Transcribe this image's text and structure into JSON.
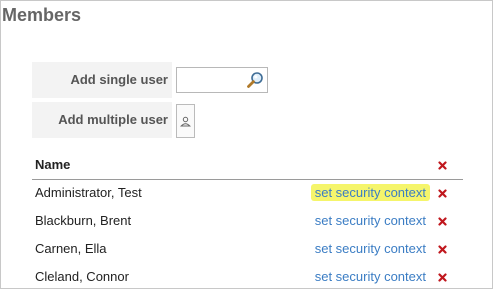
{
  "panel": {
    "title": "Members"
  },
  "add": {
    "single_label": "Add single user",
    "multiple_label": "Add multiple user",
    "search_value": "",
    "search_placeholder": ""
  },
  "table": {
    "header_name": "Name",
    "rows": [
      {
        "name": "Administrator, Test",
        "action": "set security context",
        "highlighted": true
      },
      {
        "name": "Blackburn, Brent",
        "action": "set security context",
        "highlighted": false
      },
      {
        "name": "Carnen, Ella",
        "action": "set security context",
        "highlighted": false
      },
      {
        "name": "Cleland, Connor",
        "action": "set security context",
        "highlighted": false
      }
    ]
  },
  "colors": {
    "link": "#3b7dc4",
    "highlight": "#f5f56b",
    "remove": "#c0171d"
  },
  "icons": {
    "search": "magnifier-icon",
    "picker": "user-picker-icon",
    "remove": "red-x-icon"
  }
}
